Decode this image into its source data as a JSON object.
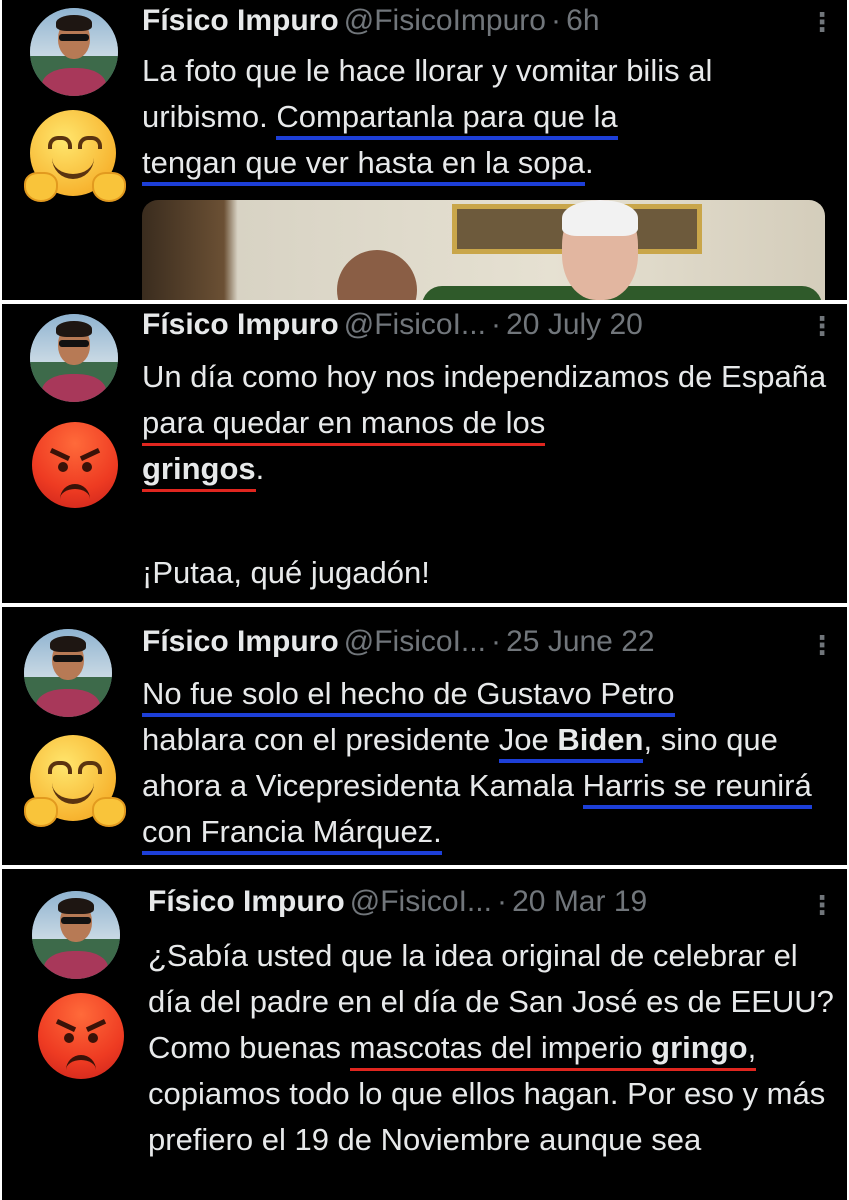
{
  "tweets": [
    {
      "name": "Físico Impuro",
      "handle": "@FisicoImpuro",
      "dot": "·",
      "time": "6h",
      "more": "⋮",
      "emoji": "hugging-face",
      "segments": [
        "La foto que le hace llorar y vomitar bilis al uribismo. ",
        "Compartanla para que la",
        "tengan que ver hasta en la sopa"
      ],
      "tail": "."
    },
    {
      "name": "Físico Impuro",
      "handle": "@FisicoI...",
      "dot": "·",
      "time": "20 July 20",
      "more": "⋮",
      "emoji": "angry-face",
      "segments": [
        "Un día como hoy nos independizamos de España ",
        "para quedar en manos de los",
        "gringos",
        "."
      ],
      "footer": "¡Putaa, qué jugadón!"
    },
    {
      "name": "Físico Impuro",
      "handle": "@FisicoI...",
      "dot": "·",
      "time": "25 June 22",
      "more": "⋮",
      "emoji": "hugging-face",
      "segments": [
        "No fue solo el hecho de Gustavo Petro",
        "hablara con el presidente ",
        "Joe ",
        "Biden",
        ", sino que ahora a Vicepresidenta Kamala ",
        "Harris se reunirá con Francia Márquez."
      ]
    },
    {
      "name": "Físico Impuro",
      "handle": "@FisicoI...",
      "dot": "·",
      "time": "20 Mar 19",
      "more": "⋮",
      "emoji": "angry-face",
      "segments": [
        "¿Sabía usted que la idea original de celebrar el día del padre en el día de San José es de EEUU? Como buenas ",
        "mascotas del imperio ",
        "gringo",
        ",",
        " copiamos todo lo que ellos hagan. Por eso y más prefiero el 19 de Noviembre aunque sea"
      ]
    }
  ],
  "colors": {
    "background": "#000000",
    "text": "#e7e9ea",
    "muted": "#71767b",
    "underline_blue": "#1d3fd8",
    "underline_red": "#e0261f"
  }
}
